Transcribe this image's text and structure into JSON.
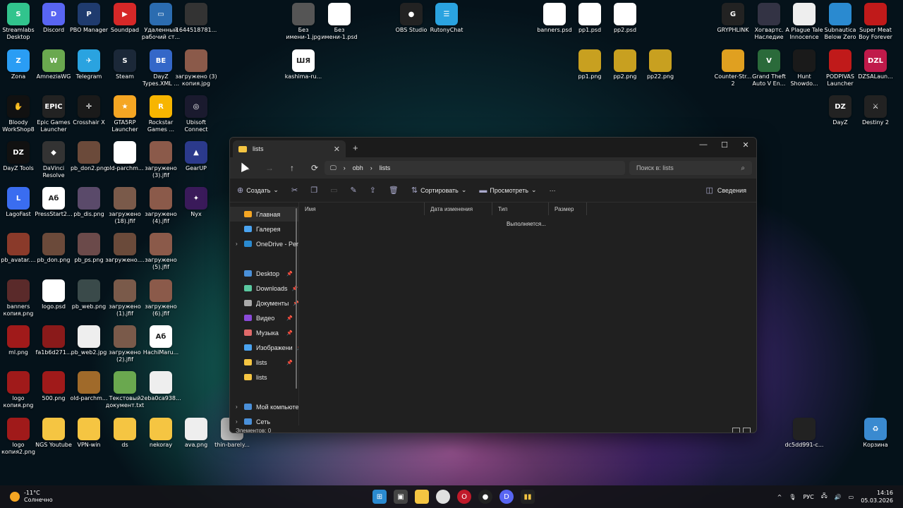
{
  "desktop": {
    "icons": [
      {
        "label": "Streamlabs Desktop",
        "color": "#31c48d",
        "glyph": "S"
      },
      {
        "label": "Discord",
        "color": "#5865f2",
        "glyph": "D"
      },
      {
        "label": "PBO Manager",
        "color": "#1f3b6e",
        "glyph": "P"
      },
      {
        "label": "Soundpad",
        "color": "#d62828",
        "glyph": "▶"
      },
      {
        "label": "Удаленный рабочий ст...",
        "color": "#2b6cb0",
        "glyph": "▭"
      },
      {
        "label": "1644518781...",
        "color": "#333333",
        "glyph": ""
      },
      {
        "label": "Zona",
        "color": "#2a9df4",
        "glyph": "Z"
      },
      {
        "label": "AmneziaWG",
        "color": "#6aa84f",
        "glyph": "W"
      },
      {
        "label": "Telegram",
        "color": "#2aa3e0",
        "glyph": "✈"
      },
      {
        "label": "Steam",
        "color": "#1b2838",
        "glyph": "S"
      },
      {
        "label": "DayZ Types.XML ...",
        "color": "#3467c8",
        "glyph": "BE"
      },
      {
        "label": "загружено (3) копия.jpg",
        "color": "#8b5a4a",
        "glyph": ""
      },
      {
        "label": "Bloody WorkShop8",
        "color": "#111111",
        "glyph": "✋"
      },
      {
        "label": "Epic Games Launcher",
        "color": "#222222",
        "glyph": "EPIC"
      },
      {
        "label": "Crosshair X",
        "color": "#1a1a1a",
        "glyph": "✛"
      },
      {
        "label": "GTA5RP Launcher",
        "color": "#f5a623",
        "glyph": "★"
      },
      {
        "label": "Rockstar Games ...",
        "color": "#f7b500",
        "glyph": "R"
      },
      {
        "label": "Ubisoft Connect",
        "color": "#1a1a2e",
        "glyph": "◎"
      },
      {
        "label": "DayZ Tools",
        "color": "#111111",
        "glyph": "DZ"
      },
      {
        "label": "DaVinci Resolve",
        "color": "#333333",
        "glyph": "◆"
      },
      {
        "label": "pb_don2.png",
        "color": "#6b4a3a",
        "glyph": ""
      },
      {
        "label": "old-parchm...",
        "color": "#ffffff",
        "glyph": ""
      },
      {
        "label": "загружено (3).jfif",
        "color": "#8b5a4a",
        "glyph": ""
      },
      {
        "label": "GearUP",
        "color": "#2b3a8c",
        "glyph": "▲"
      },
      {
        "label": "LagoFast",
        "color": "#3a6df0",
        "glyph": "L"
      },
      {
        "label": "PressStart2...",
        "color": "#ffffff",
        "glyph": "Аб"
      },
      {
        "label": "pb_dis.png",
        "color": "#5a4a6a",
        "glyph": ""
      },
      {
        "label": "загружено (18).jfif",
        "color": "#7a5a4a",
        "glyph": ""
      },
      {
        "label": "загружено (4).jfif",
        "color": "#8b5a4a",
        "glyph": ""
      },
      {
        "label": "Nyx",
        "color": "#3a1a5a",
        "glyph": "✦"
      },
      {
        "label": "pb_avatar....",
        "color": "#8a3a2a",
        "glyph": ""
      },
      {
        "label": "pb_don.png",
        "color": "#6b4a3a",
        "glyph": ""
      },
      {
        "label": "pb_ps.png",
        "color": "#6b4a4a",
        "glyph": ""
      },
      {
        "label": "загружено....",
        "color": "#6a4a3a",
        "glyph": ""
      },
      {
        "label": "загружено (5).jfif",
        "color": "#8b5a4a",
        "glyph": ""
      },
      {
        "label": "banners копия.png",
        "color": "#5a2a2a",
        "glyph": ""
      },
      {
        "label": "logo.psd",
        "color": "#ffffff",
        "glyph": ""
      },
      {
        "label": "pb_web.png",
        "color": "#3a4a4a",
        "glyph": ""
      },
      {
        "label": "загружено (1).jfif",
        "color": "#7a5a4a",
        "glyph": ""
      },
      {
        "label": "загружено (6).jfif",
        "color": "#8b5a4a",
        "glyph": ""
      },
      {
        "label": "ml.png",
        "color": "#a01a1a",
        "glyph": ""
      },
      {
        "label": "fa1b6d271...",
        "color": "#8a1a1a",
        "glyph": ""
      },
      {
        "label": "pb_web2.jpg",
        "color": "#eeeeee",
        "glyph": ""
      },
      {
        "label": "загружено (2).jfif",
        "color": "#7a5a4a",
        "glyph": ""
      },
      {
        "label": "HachiMaru...",
        "color": "#ffffff",
        "glyph": "Аб"
      },
      {
        "label": "logo копия.png",
        "color": "#a01a1a",
        "glyph": ""
      },
      {
        "label": "500.png",
        "color": "#a01a1a",
        "glyph": ""
      },
      {
        "label": "old-parchm...",
        "color": "#a06a2a",
        "glyph": ""
      },
      {
        "label": "Текстовый документ.txt",
        "color": "#6aa84f",
        "glyph": ""
      },
      {
        "label": "2eba0ca938...",
        "color": "#eeeeee",
        "glyph": ""
      },
      {
        "label": "logo копия2.png",
        "color": "#a01a1a",
        "glyph": ""
      },
      {
        "label": "NGS Youtube",
        "color": "#f5c542",
        "glyph": ""
      },
      {
        "label": "VPN-win",
        "color": "#f5c542",
        "glyph": ""
      },
      {
        "label": "ds",
        "color": "#f5c542",
        "glyph": ""
      },
      {
        "label": "nekoray",
        "color": "#f5c542",
        "glyph": ""
      },
      {
        "label": "ava.png",
        "color": "#eeeeee",
        "glyph": ""
      },
      {
        "label": "thin-barely...",
        "color": "#cccccc",
        "glyph": ""
      },
      {
        "label": "Без имени-1.jpg",
        "color": "#555555",
        "glyph": ""
      },
      {
        "label": "Без имени-1.psd",
        "color": "#ffffff",
        "glyph": ""
      },
      {
        "label": "kashima-ru...",
        "color": "#ffffff",
        "glyph": "ШЯ"
      },
      {
        "label": "OBS Studio",
        "color": "#222222",
        "glyph": "●"
      },
      {
        "label": "RutonyChat",
        "color": "#2aa3e0",
        "glyph": "☰"
      },
      {
        "label": "banners.psd",
        "color": "#ffffff",
        "glyph": ""
      },
      {
        "label": "pp1.psd",
        "color": "#ffffff",
        "glyph": ""
      },
      {
        "label": "pp2.psd",
        "color": "#ffffff",
        "glyph": ""
      },
      {
        "label": "pp1.png",
        "color": "#c8a020",
        "glyph": ""
      },
      {
        "label": "pp2.png",
        "color": "#c8a020",
        "glyph": ""
      },
      {
        "label": "pp22.png",
        "color": "#c8a020",
        "glyph": ""
      },
      {
        "label": "GRYPHLINK",
        "color": "#222222",
        "glyph": "G"
      },
      {
        "label": "Хогвартс. Наследие",
        "color": "#333344",
        "glyph": ""
      },
      {
        "label": "A Plague Tale Innocence",
        "color": "#eeeeee",
        "glyph": ""
      },
      {
        "label": "Subnautica Below Zero",
        "color": "#2a8ad0",
        "glyph": ""
      },
      {
        "label": "Super Meat Boy Forever",
        "color": "#c01a1a",
        "glyph": ""
      },
      {
        "label": "Counter-Str... 2",
        "color": "#e0a020",
        "glyph": ""
      },
      {
        "label": "Grand Theft Auto V En...",
        "color": "#2a6a3a",
        "glyph": "V"
      },
      {
        "label": "Hunt Showdo...",
        "color": "#1a1a1a",
        "glyph": ""
      },
      {
        "label": "PODPIVAS Launcher",
        "color": "#c01a1a",
        "glyph": ""
      },
      {
        "label": "DZSALaun...",
        "color": "#c01a4a",
        "glyph": "DZL"
      },
      {
        "label": "DayZ",
        "color": "#222222",
        "glyph": "DZ"
      },
      {
        "label": "Destiny 2",
        "color": "#222222",
        "glyph": "⚔"
      },
      {
        "label": "dc5dd991-c...",
        "color": "#222222",
        "glyph": ""
      },
      {
        "label": "Корзина",
        "color": "#3a8ad0",
        "glyph": "♻"
      }
    ]
  },
  "explorer": {
    "tab_title": "lists",
    "new_tab": "+",
    "controls": {
      "minimize": "—",
      "maximize": "☐",
      "close": "✕"
    },
    "nav": {
      "back": "←",
      "forward": "→",
      "up": "↑",
      "refresh": "⟳"
    },
    "breadcrumb": {
      "sep": "›",
      "items": [
        "obh",
        "lists"
      ]
    },
    "search_placeholder": "Поиск в: lists",
    "commands": {
      "create": "Создать",
      "sort": "Сортировать",
      "view": "Просмотреть",
      "more": "···",
      "details": "Сведения"
    },
    "sidebar": [
      {
        "label": "Главная",
        "color": "#f5a623",
        "pinned": false
      },
      {
        "label": "Галерея",
        "color": "#4aa3f0",
        "pinned": false
      },
      {
        "label": "OneDrive - Pers",
        "color": "#2a8ad0",
        "pinned": false
      },
      {
        "label": "Desktop",
        "color": "#4a90d9",
        "pinned": true
      },
      {
        "label": "Downloads",
        "color": "#5ac8a0",
        "pinned": true
      },
      {
        "label": "Документы",
        "color": "#aaaaaa",
        "pinned": true
      },
      {
        "label": "Видео",
        "color": "#8a4ad9",
        "pinned": true
      },
      {
        "label": "Музыка",
        "color": "#e06a6a",
        "pinned": true
      },
      {
        "label": "Изображени",
        "color": "#4aa3f0",
        "pinned": true
      },
      {
        "label": "lists",
        "color": "#f5c542",
        "pinned": true
      },
      {
        "label": "lists",
        "color": "#f5c542",
        "pinned": false
      },
      {
        "label": "Мой компьюте",
        "color": "#4a90d9",
        "pinned": false
      },
      {
        "label": "Сеть",
        "color": "#4a90d9",
        "pinned": false
      }
    ],
    "columns": {
      "name": "Имя",
      "date": "Дата изменения",
      "type": "Тип",
      "size": "Размер"
    },
    "loading": "Выполняется...",
    "status": "Элементов: 0"
  },
  "taskbar": {
    "weather_temp": "-11°C",
    "weather_desc": "Солнечно",
    "lang": "РУС",
    "time": "14:16",
    "date": "05.03.2026",
    "tray_up": "^"
  }
}
